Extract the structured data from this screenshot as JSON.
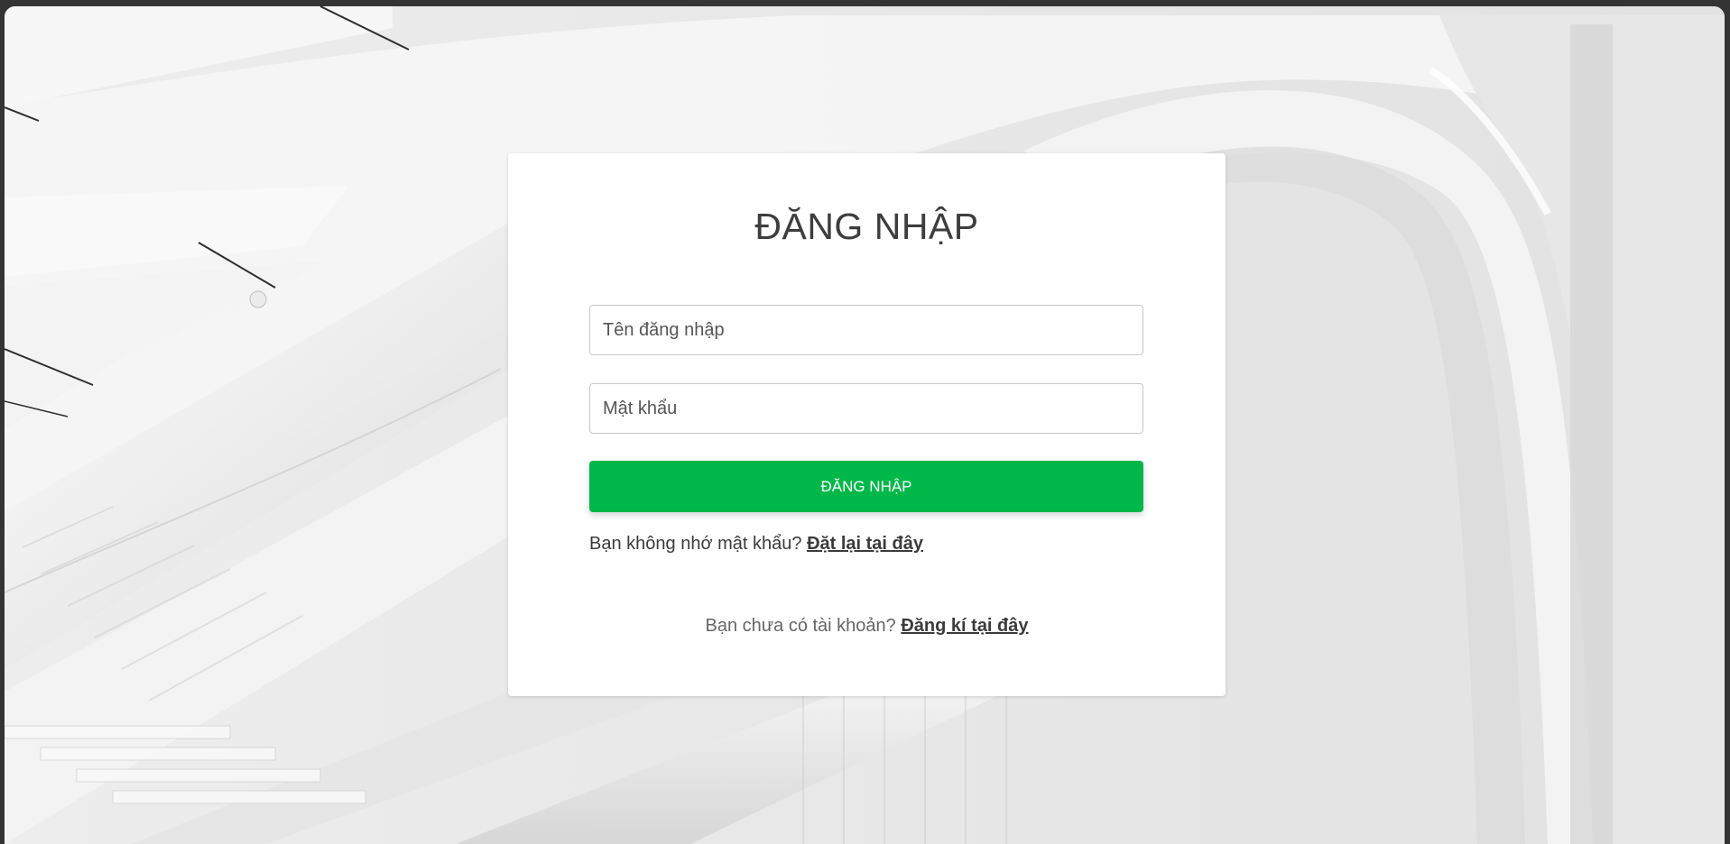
{
  "login_form": {
    "title": "ĐĂNG NHẬP",
    "username_placeholder": "Tên đăng nhập",
    "password_placeholder": "Mật khẩu",
    "submit_label": "ĐĂNG NHẬP",
    "forgot_prompt": "Bạn không nhớ mật khẩu?",
    "forgot_link": "Đặt lại tại đây",
    "register_prompt": "Bạn chưa có tài khoản?",
    "register_link": "Đăng kí tại đây"
  },
  "colors": {
    "primary_button": "#00b74a",
    "card_background": "#ffffff"
  }
}
